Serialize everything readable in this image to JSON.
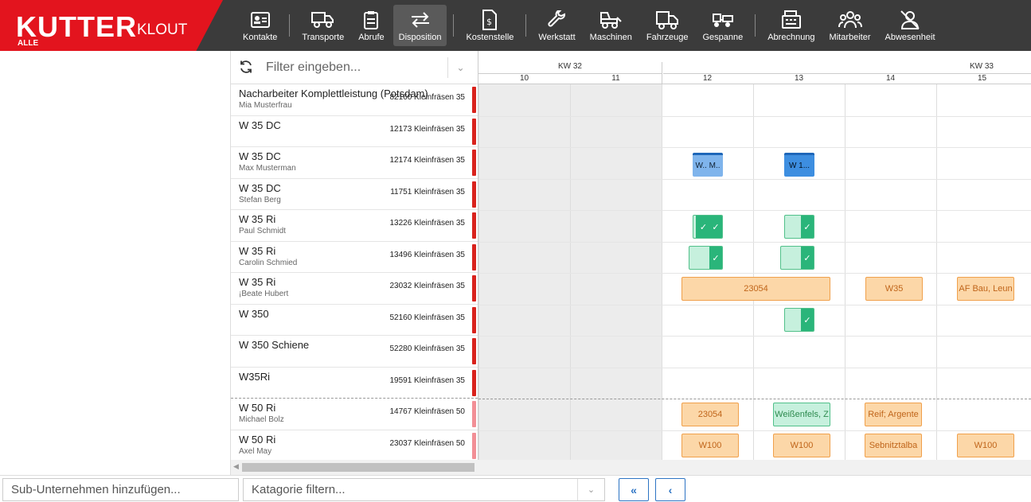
{
  "logo": {
    "main": "KUTTER",
    "sub": "KLOUT",
    "tag": "ALLE"
  },
  "nav": [
    {
      "label": "Kontakte",
      "icon": "contact-card-icon",
      "active": false
    },
    {
      "label": "Transporte",
      "icon": "truck-icon",
      "active": false
    },
    {
      "label": "Abrufe",
      "icon": "clipboard-icon",
      "active": false
    },
    {
      "label": "Disposition",
      "icon": "arrows-exchange-icon",
      "active": true
    },
    {
      "label": "Kostenstelle",
      "icon": "invoice-icon",
      "active": false
    },
    {
      "label": "Werkstatt",
      "icon": "wrench-icon",
      "active": false
    },
    {
      "label": "Maschinen",
      "icon": "machine-icon",
      "active": false
    },
    {
      "label": "Fahrzeuge",
      "icon": "van-icon",
      "active": false
    },
    {
      "label": "Gespanne",
      "icon": "trailer-icon",
      "active": false
    },
    {
      "label": "Abrechnung",
      "icon": "cash-register-icon",
      "active": false
    },
    {
      "label": "Mitarbeiter",
      "icon": "users-icon",
      "active": false
    },
    {
      "label": "Abwesenheit",
      "icon": "user-absent-icon",
      "active": false
    }
  ],
  "filter": {
    "placeholder": "Filter eingeben..."
  },
  "resources": [
    {
      "name": "Nacharbeiter Komplettleistung (Potsdam)",
      "person": "Mia Musterfrau",
      "num": "82160 Kleinfräsen 35",
      "flag": "red"
    },
    {
      "name": "W 35 DC",
      "person": "",
      "num": "12173 Kleinfräsen 35",
      "flag": "red"
    },
    {
      "name": "W 35 DC",
      "person": "Max Musterman",
      "num": "12174 Kleinfräsen 35",
      "flag": "red"
    },
    {
      "name": "W 35 DC",
      "person": "Stefan Berg",
      "num": "11751 Kleinfräsen 35",
      "flag": "red"
    },
    {
      "name": "W 35 Ri",
      "person": "Paul Schmidt",
      "num": "13226 Kleinfräsen 35",
      "flag": "red"
    },
    {
      "name": "W 35 Ri",
      "person": "Carolin Schmied",
      "num": "13496 Kleinfräsen 35",
      "flag": "red"
    },
    {
      "name": "W 35 Ri",
      "person": "¡Beate Hubert",
      "num": "23032 Kleinfräsen 35",
      "flag": "red"
    },
    {
      "name": "W 350",
      "person": "",
      "num": "52160 Kleinfräsen 35",
      "flag": "red"
    },
    {
      "name": "W 350 Schiene",
      "person": "",
      "num": "52280 Kleinfräsen 35",
      "flag": "red"
    },
    {
      "name": "W35Ri",
      "person": "",
      "num": "19591 Kleinfräsen 35",
      "flag": "red"
    },
    {
      "name": "W 50 Ri",
      "person": "Michael Bolz",
      "num": "14767 Kleinfräsen 50",
      "flag": "light"
    },
    {
      "name": "W 50 Ri",
      "person": "Axel May",
      "num": "23037 Kleinfräsen 50",
      "flag": "light"
    }
  ],
  "calendar": {
    "weeks": [
      "KW 32",
      "KW 33"
    ],
    "days": [
      "10",
      "11",
      "12",
      "13",
      "14",
      "15"
    ],
    "events": {
      "r2_blue1": "W.. M..",
      "r2_blue2": "W 1...",
      "r6_big": "23054",
      "r6_w35": "W35",
      "r6_af": "AF Bau, Leun",
      "r10_a": "23054",
      "r10_b": "Weißenfels, Z",
      "r10_c": "Reif; Argente",
      "r11_a": "W100",
      "r11_b": "W100",
      "r11_c": "Sebnitztalba",
      "r11_d": "W100"
    },
    "checkmark": "✓"
  },
  "bottom": {
    "sub_placeholder": "Sub-Unternehmen hinzufügen...",
    "cat_placeholder": "Katagorie filtern...",
    "first_btn": "«",
    "prev_btn": "‹"
  }
}
